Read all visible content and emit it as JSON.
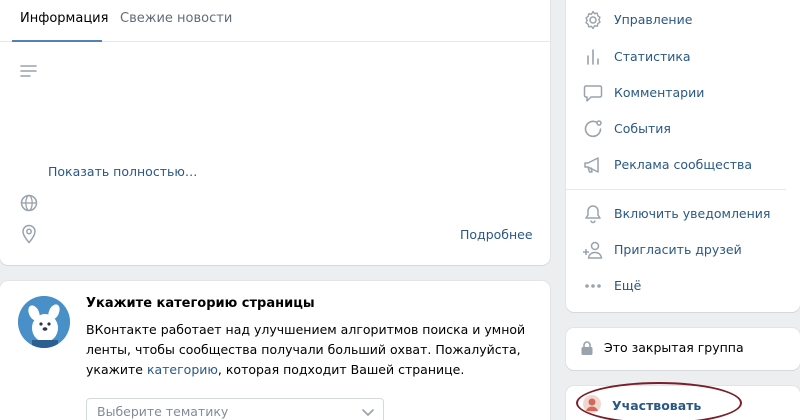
{
  "tabs": [
    {
      "label": "Информация",
      "active": true
    },
    {
      "label": "Свежие новости",
      "active": false
    }
  ],
  "info": {
    "show_more": "Показать полностью…",
    "more_link": "Подробнее",
    "icons": [
      "description-lines-icon",
      "globe-icon",
      "location-pin-icon"
    ]
  },
  "category": {
    "title": "Укажите категорию страницы",
    "text_before": "ВКонтакте работает над улучшением алгоритмов поиска и умной ленты, чтобы сообщества получали больший охват. Пожалуйста, укажите ",
    "link": "категорию",
    "text_after": ", которая подходит Вашей странице.",
    "select_placeholder": "Выберите тематику"
  },
  "menu": {
    "items": [
      {
        "label": "Управление",
        "icon": "gear-icon"
      },
      {
        "label": "Статистика",
        "icon": "stats-icon"
      },
      {
        "label": "Комментарии",
        "icon": "comment-icon"
      },
      {
        "label": "События",
        "icon": "events-icon"
      },
      {
        "label": "Реклама сообщества",
        "icon": "megaphone-icon"
      },
      {
        "label": "Включить уведомления",
        "icon": "bell-icon"
      },
      {
        "label": "Пригласить друзей",
        "icon": "add-user-icon"
      },
      {
        "label": "Ещё",
        "icon": "more-dots-icon"
      }
    ]
  },
  "group_status": {
    "label": "Это закрытая группа",
    "icon": "lock-icon"
  },
  "join": {
    "label": "Участвовать"
  },
  "colors": {
    "accent": "#2a5885",
    "background": "#edeef0",
    "tab_underline": "#5181b8",
    "highlight": "#7a1f2a"
  }
}
